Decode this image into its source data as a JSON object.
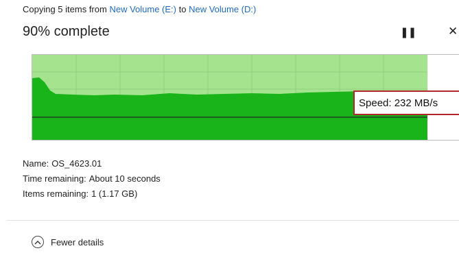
{
  "header": {
    "prefix": "Copying 5 items from",
    "source": "New Volume (E:)",
    "mid": "to",
    "destination": "New Volume (D:)"
  },
  "progress": {
    "title": "90% complete",
    "percent": 90
  },
  "controls": {
    "pause_icon": "pause-icon",
    "close_icon": "close-icon",
    "pause_glyph": "❚❚",
    "close_glyph": "✕"
  },
  "graph": {
    "speed_label": "Speed:",
    "speed_value": "232",
    "speed_unit": "MB/s",
    "colors": {
      "progress_fill": "#a5e38f",
      "speed_fill": "#19b31a",
      "speed_line": "#1f3f1f",
      "grid": "#8fcf7c",
      "highlight_border": "#b3262b"
    }
  },
  "details": {
    "name_label": "Name:",
    "name_value": "OS_4623.01",
    "time_label": "Time remaining:",
    "time_value": "About 10 seconds",
    "items_label": "Items remaining:",
    "items_value": "1 (1.17 GB)"
  },
  "footer": {
    "fewer_details": "Fewer details",
    "icon": "chevron-up-icon"
  }
}
